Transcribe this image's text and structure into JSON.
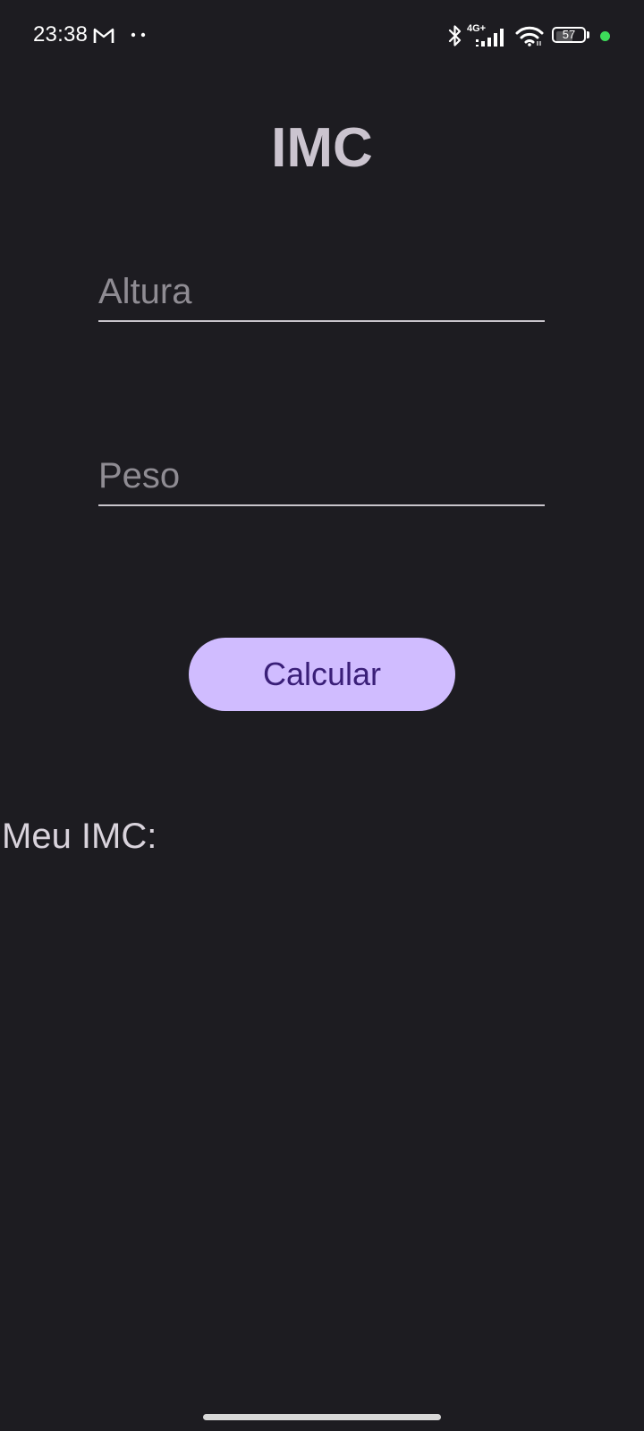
{
  "status_bar": {
    "time": "23:38",
    "network": "4G+",
    "battery_level": "57",
    "battery_fraction": 0.57,
    "notification_icon": "gmail-icon",
    "dot_color": "#3ddc5a"
  },
  "app": {
    "title": "IMC",
    "altura": {
      "placeholder": "Altura",
      "value": ""
    },
    "peso": {
      "placeholder": "Peso",
      "value": ""
    },
    "calculate_label": "Calcular",
    "result_label": "Meu IMC:"
  },
  "colors": {
    "background": "#1d1c21",
    "title": "#cbc4cf",
    "button": "#d0bcff",
    "button_text": "#3a1f78"
  }
}
